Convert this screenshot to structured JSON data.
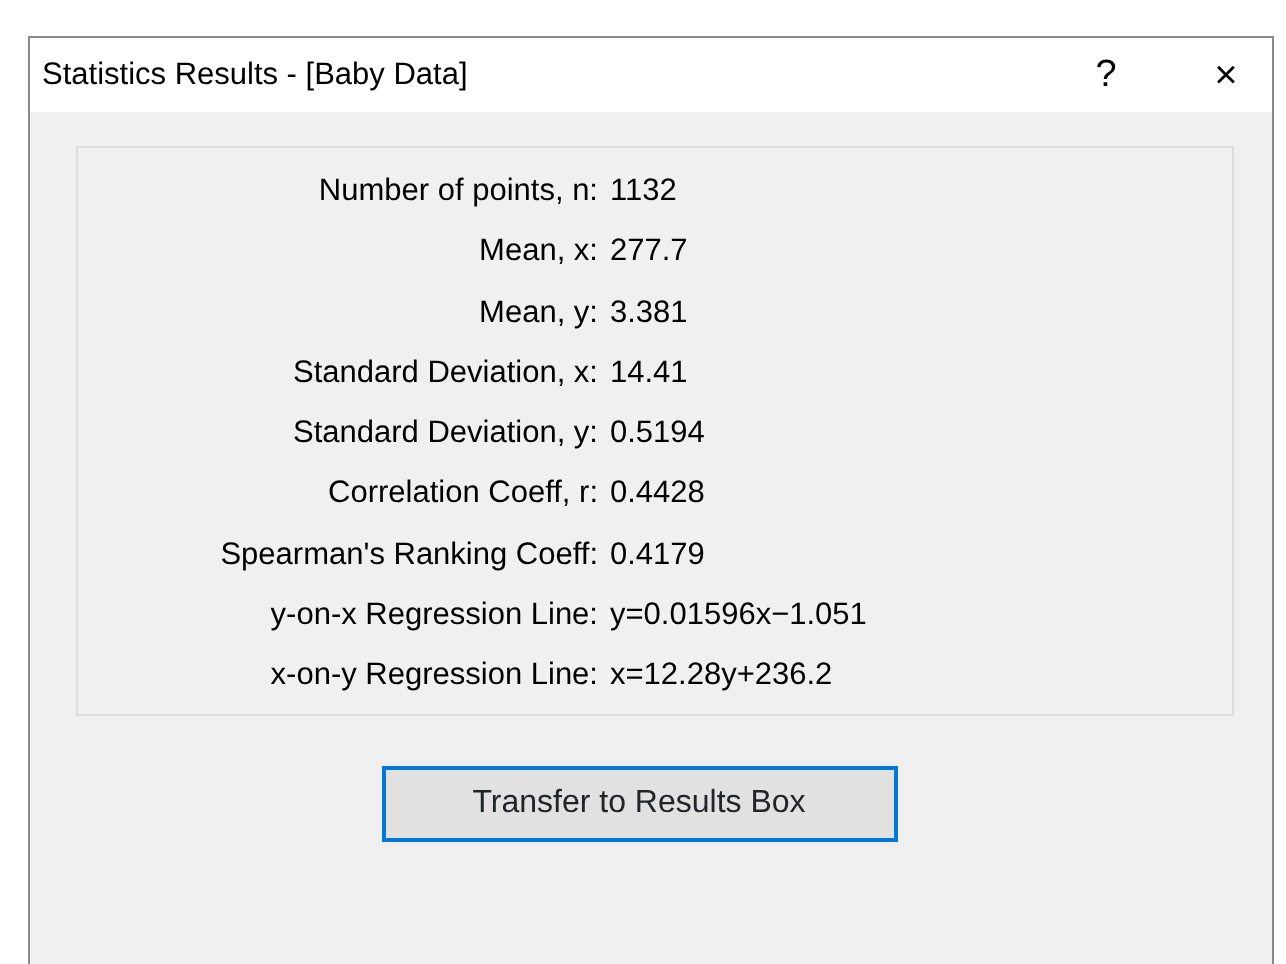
{
  "window": {
    "title": "Statistics Results - [Baby Data]",
    "help_glyph": "?",
    "close_glyph": "×"
  },
  "results": [
    {
      "label": "Number of points, n:",
      "value": "1132"
    },
    {
      "label": "Mean, x:",
      "value": "277.7"
    },
    {
      "label": "Mean, y:",
      "value": "3.381"
    },
    {
      "label": "Standard Deviation, x:",
      "value": "14.41"
    },
    {
      "label": "Standard Deviation, y:",
      "value": "0.5194"
    },
    {
      "label": "Correlation Coeff, r:",
      "value": "0.4428"
    },
    {
      "label": "Spearman's Ranking Coeff:",
      "value": "0.4179"
    },
    {
      "label": "y-on-x Regression Line:",
      "value": "y=0.01596x−1.051"
    },
    {
      "label": "x-on-y Regression Line:",
      "value": "x=12.28y+236.2"
    }
  ],
  "buttons": [
    {
      "label": "Transfer to Results Box",
      "focused": true
    }
  ]
}
